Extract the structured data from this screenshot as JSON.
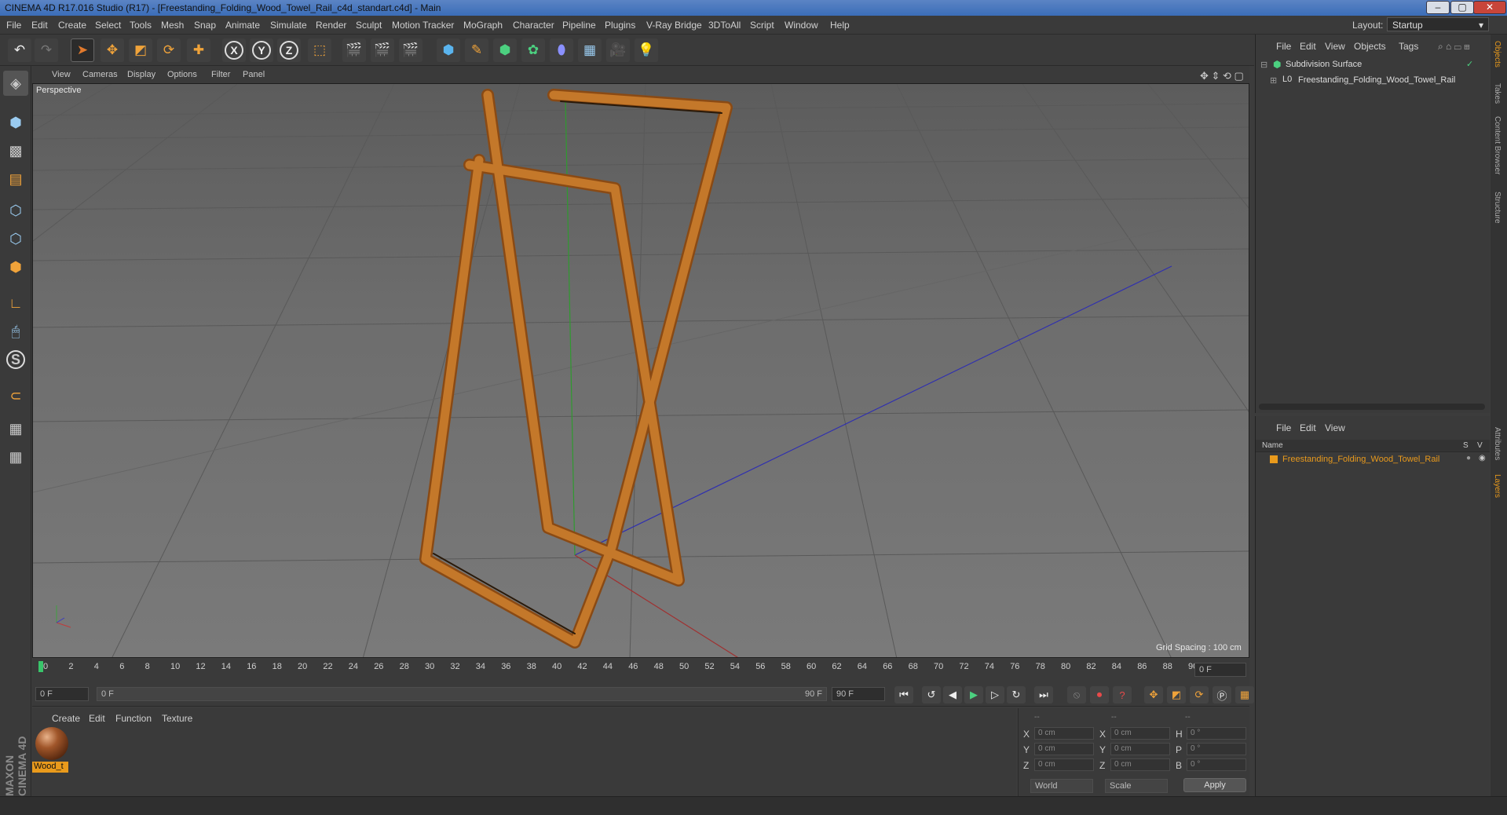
{
  "window": {
    "title": "CINEMA 4D R17.016 Studio (R17) - [Freestanding_Folding_Wood_Towel_Rail_c4d_standart.c4d] - Main"
  },
  "menu": [
    "File",
    "Edit",
    "Create",
    "Select",
    "Tools",
    "Mesh",
    "Snap",
    "Animate",
    "Simulate",
    "Render",
    "Sculpt",
    "Motion Tracker",
    "MoGraph",
    "Character",
    "Pipeline",
    "Plugins",
    "V-Ray Bridge",
    "3DToAll",
    "Script",
    "Window",
    "Help"
  ],
  "layout": {
    "label": "Layout:",
    "value": "Startup"
  },
  "toolbar": {
    "x": "X",
    "y": "Y",
    "z": "Z"
  },
  "viewport": {
    "menu": [
      "View",
      "Cameras",
      "Display",
      "Options",
      "Filter",
      "Panel"
    ],
    "camera": "Perspective",
    "grid": "Grid Spacing : 100 cm"
  },
  "timeline": {
    "ticks": [
      "0",
      "2",
      "4",
      "6",
      "8",
      "10",
      "12",
      "14",
      "16",
      "18",
      "20",
      "22",
      "24",
      "26",
      "28",
      "30",
      "32",
      "34",
      "36",
      "38",
      "40",
      "42",
      "44",
      "46",
      "48",
      "50",
      "52",
      "54",
      "56",
      "58",
      "60",
      "62",
      "64",
      "66",
      "68",
      "70",
      "72",
      "74",
      "76",
      "78",
      "80",
      "82",
      "84",
      "86",
      "88",
      "90"
    ],
    "current": "0 F",
    "start": "0 F",
    "range_start": "0 F",
    "range_end": "90 F",
    "end": "90 F"
  },
  "materials": {
    "menu": [
      "Create",
      "Edit",
      "Function",
      "Texture"
    ],
    "item": "Wood_t"
  },
  "coords": {
    "header": [
      "--",
      "--",
      "--"
    ],
    "rows": [
      [
        "X",
        "0 cm",
        "X",
        "0 cm",
        "H",
        "0 °"
      ],
      [
        "Y",
        "0 cm",
        "Y",
        "0 cm",
        "P",
        "0 °"
      ],
      [
        "Z",
        "0 cm",
        "Z",
        "0 cm",
        "B",
        "0 °"
      ]
    ],
    "world": "World",
    "scale": "Scale",
    "apply": "Apply"
  },
  "objects": {
    "menu": [
      "File",
      "Edit",
      "View",
      "Objects",
      "Tags"
    ],
    "items": [
      "Subdivision Surface",
      "Freestanding_Folding_Wood_Towel_Rail"
    ]
  },
  "layers": {
    "menu": [
      "File",
      "Edit",
      "View"
    ],
    "name_header": "Name",
    "s": "S",
    "v": "V",
    "item": "Freestanding_Folding_Wood_Towel_Rail"
  },
  "side_tabs": [
    "Objects",
    "Takes",
    "Content Browser",
    "Structure",
    "Attributes",
    "Layers"
  ],
  "brand": "MAXON CINEMA 4D",
  "colors": {
    "accent": "#e99a1c",
    "wood": "#b8691f"
  }
}
